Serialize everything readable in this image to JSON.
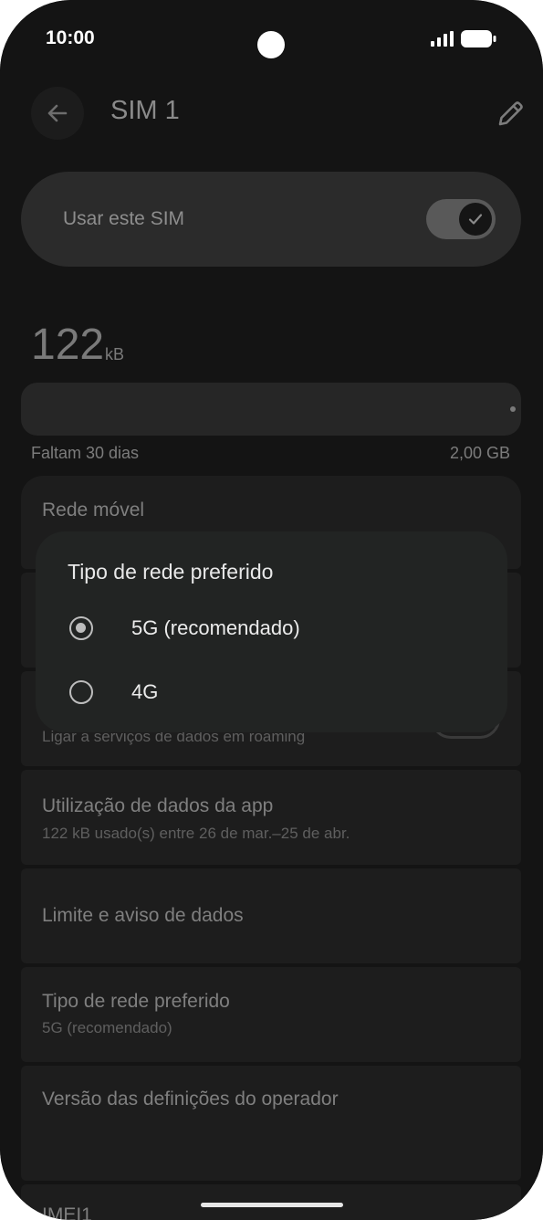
{
  "status_bar": {
    "time": "10:00"
  },
  "app_bar": {
    "title": "SIM 1",
    "back_icon": "arrow-back-icon",
    "edit_icon": "pencil-icon"
  },
  "use_sim": {
    "label": "Usar este SIM",
    "enabled": true
  },
  "usage": {
    "value": "122",
    "unit": "kB",
    "days_left": "Faltam 30 dias",
    "limit": "2,00 GB"
  },
  "settings": [
    {
      "title": "Rede móvel",
      "subtitle": ""
    },
    {
      "title": "",
      "subtitle": ""
    },
    {
      "title": "",
      "subtitle": "Ligar a serviços de dados em roaming"
    },
    {
      "title": "Utilização de dados da app",
      "subtitle": "122 kB usado(s) entre 26 de mar.–25 de abr."
    },
    {
      "title": "Limite e aviso de dados",
      "subtitle": ""
    },
    {
      "title": "Tipo de rede preferido",
      "subtitle": "5G (recomendado)"
    },
    {
      "title": "Versão das definições do operador",
      "subtitle": ""
    },
    {
      "title": "IMEI1",
      "subtitle": ""
    }
  ],
  "dialog": {
    "title": "Tipo de rede preferido",
    "options": [
      {
        "label": "5G (recomendado)",
        "selected": true
      },
      {
        "label": "4G",
        "selected": false
      }
    ]
  },
  "colors": {
    "background": "#141414",
    "card": "#1d1d1d",
    "dialog": "#222423",
    "accent": "#bdbdbd"
  }
}
